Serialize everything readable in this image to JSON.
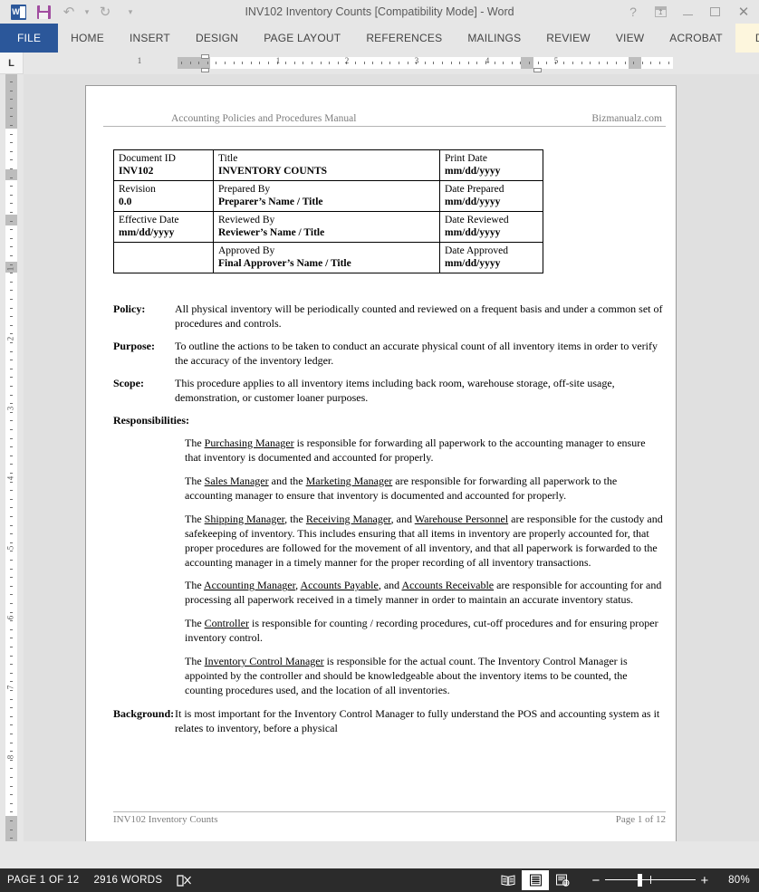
{
  "window": {
    "title": "INV102 Inventory Counts [Compatibility Mode] - Word",
    "quick_access": [
      {
        "name": "word-logo",
        "label": "W"
      },
      {
        "name": "save",
        "label": "Save"
      },
      {
        "name": "undo",
        "label": "↰"
      },
      {
        "name": "undo-dropdown",
        "label": "▾"
      },
      {
        "name": "redo",
        "label": "↻"
      },
      {
        "name": "customize-qat",
        "label": "▾"
      }
    ],
    "controls": {
      "help": "?",
      "ribbon_display_options": "Ribbon Display Options",
      "minimize": "Minimize",
      "restore": "Restore Down",
      "close": "✕"
    }
  },
  "ribbon": {
    "file_tab": "FILE",
    "tabs": [
      "HOME",
      "INSERT",
      "DESIGN",
      "PAGE LAYOUT",
      "REFERENCES",
      "MAILINGS",
      "REVIEW",
      "VIEW",
      "ACROBAT"
    ],
    "contextual_tab": "DESIGN",
    "scroll_right": "▸",
    "file_tab_color": "#2b579a",
    "contextual_tab_color": "#fdf6dd"
  },
  "rulers": {
    "corner_tab_label": "L",
    "horizontal_numbers": [
      "1",
      "1",
      "2",
      "3",
      "4",
      "5"
    ],
    "vertical_numbers": [
      "1",
      "2",
      "3",
      "4",
      "5",
      "6",
      "7",
      "8"
    ]
  },
  "document": {
    "header": {
      "left": "Accounting Policies and Procedures Manual",
      "right": "Bizmanualz.com"
    },
    "info_table": [
      [
        {
          "label": "Document ID",
          "value": "INV102"
        },
        {
          "label": "Title",
          "value": "INVENTORY COUNTS"
        },
        {
          "label": "Print Date",
          "value": "mm/dd/yyyy"
        }
      ],
      [
        {
          "label": "Revision",
          "value": "0.0"
        },
        {
          "label": "Prepared By",
          "value": "Preparer’s Name / Title"
        },
        {
          "label": "Date Prepared",
          "value": "mm/dd/yyyy"
        }
      ],
      [
        {
          "label": "Effective Date",
          "value": "mm/dd/yyyy"
        },
        {
          "label": "Reviewed By",
          "value": "Reviewer’s Name / Title"
        },
        {
          "label": "Date Reviewed",
          "value": "mm/dd/yyyy"
        }
      ],
      [
        {
          "label": "",
          "value": ""
        },
        {
          "label": "Approved By",
          "value": "Final Approver’s Name / Title"
        },
        {
          "label": "Date Approved",
          "value": "mm/dd/yyyy"
        }
      ]
    ],
    "sections": [
      {
        "label": "Policy:",
        "text": "All physical inventory will be periodically counted and reviewed on a frequent basis and under a common set of procedures and controls."
      },
      {
        "label": "Purpose:",
        "text": "To outline the actions to be taken to conduct an accurate physical count of all inventory items in order to verify the accuracy of the inventory ledger."
      },
      {
        "label": "Scope:",
        "text": "This procedure applies to all inventory items including back room, warehouse storage, off-site usage, demonstration, or customer loaner purposes."
      }
    ],
    "responsibilities_heading": "Responsibilities:",
    "responsibilities": [
      {
        "parts": [
          {
            "t": "The ",
            "u": false
          },
          {
            "t": "Purchasing Manager",
            "u": true
          },
          {
            "t": " is responsible for forwarding all paperwork to the accounting manager to ensure that inventory is documented and accounted for properly.",
            "u": false
          }
        ]
      },
      {
        "parts": [
          {
            "t": "The ",
            "u": false
          },
          {
            "t": "Sales Manager",
            "u": true
          },
          {
            "t": " and the ",
            "u": false
          },
          {
            "t": "Marketing Manager",
            "u": true
          },
          {
            "t": " are responsible for forwarding all paperwork to the accounting manager to ensure that inventory is documented and accounted for properly.",
            "u": false
          }
        ]
      },
      {
        "parts": [
          {
            "t": "The ",
            "u": false
          },
          {
            "t": "Shipping Manager",
            "u": true
          },
          {
            "t": ", the ",
            "u": false
          },
          {
            "t": "Receiving Manager",
            "u": true
          },
          {
            "t": ", and ",
            "u": false
          },
          {
            "t": "Warehouse Personnel",
            "u": true
          },
          {
            "t": " are responsible for the custody and safekeeping of inventory.  This includes ensuring that all items in inventory are properly accounted for, that proper procedures are followed for the movement of all inventory, and that all paperwork is forwarded to the accounting manager in a timely manner for the proper recording of all inventory transactions.",
            "u": false
          }
        ]
      },
      {
        "parts": [
          {
            "t": "The ",
            "u": false
          },
          {
            "t": "Accounting Manager",
            "u": true
          },
          {
            "t": ", ",
            "u": false
          },
          {
            "t": "Accounts Payable",
            "u": true
          },
          {
            "t": ", and ",
            "u": false
          },
          {
            "t": "Accounts Receivable",
            "u": true
          },
          {
            "t": " are responsible for accounting for and processing all paperwork received in a timely manner in order to maintain an accurate inventory status.",
            "u": false
          }
        ]
      },
      {
        "parts": [
          {
            "t": "The ",
            "u": false
          },
          {
            "t": "Controller",
            "u": true
          },
          {
            "t": " is responsible for counting / recording procedures, cut-off procedures and for ensuring proper inventory control.",
            "u": false
          }
        ]
      },
      {
        "parts": [
          {
            "t": "The ",
            "u": false
          },
          {
            "t": "Inventory Control Manager",
            "u": true
          },
          {
            "t": " is responsible for the actual count.  The Inventory Control Manager is appointed by the controller and should be knowledgeable about the inventory items to be counted, the counting procedures used, and the location of all inventories.",
            "u": false
          }
        ]
      }
    ],
    "background": {
      "label": "Background:",
      "text": "It is most important for the Inventory Control Manager to fully understand the POS and accounting system as it relates to inventory, before a physical"
    },
    "footer": {
      "left": "INV102 Inventory Counts",
      "right": "Page 1 of 12"
    }
  },
  "statusbar": {
    "page_count": "PAGE 1 OF 12",
    "word_count": "2916 WORDS",
    "proofing_label": "Proofing errors",
    "views": [
      {
        "name": "read-mode-view",
        "label": "Read Mode",
        "active": false
      },
      {
        "name": "print-layout-view",
        "label": "Print Layout",
        "active": true
      },
      {
        "name": "web-layout-view",
        "label": "Web Layout",
        "active": false
      }
    ],
    "zoom_out": "−",
    "zoom_in": "+",
    "zoom_level": "80%",
    "background_color": "#2b2b2b"
  }
}
